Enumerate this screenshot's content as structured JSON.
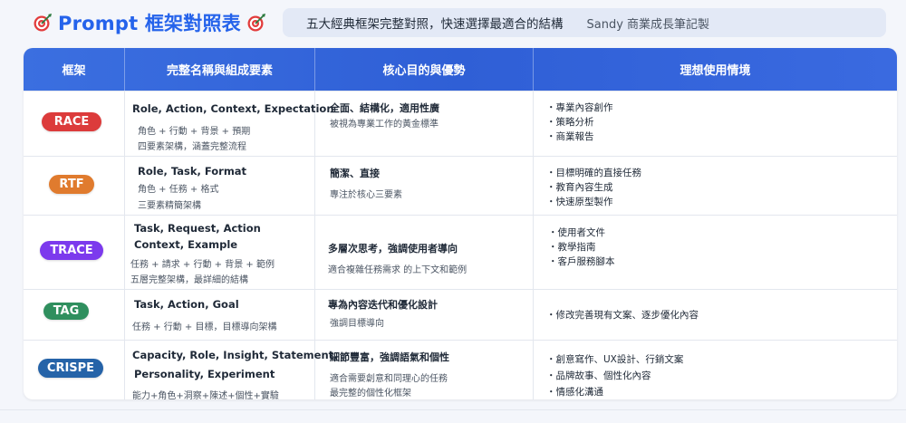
{
  "header": {
    "title": "Prompt 框架對照表",
    "subtitle": "五大經典框架完整對照，快速選擇最適合的結構",
    "author": "Sandy 商業成長筆記製"
  },
  "columns": [
    "框架",
    "完整名稱與組成要素",
    "核心目的與優勢",
    "理想使用情境"
  ],
  "colors": {
    "accent": "#2563eb",
    "race": "#dc3b3b",
    "rtf": "#e07b2e",
    "trace": "#7c3aed",
    "tag": "#2f8f5e",
    "crispe": "#2563a8"
  },
  "rows": [
    {
      "badge": "RACE",
      "name_lines": [
        "Role, Action, Context, Expectation"
      ],
      "zh_lines": [
        "角色 + 行動 + 背景 + 預期",
        "四要素架構，涵蓋完整流程"
      ],
      "purpose": "全面、結構化，適用性廣",
      "purpose_desc": [
        "被視為專業工作的黃金標準"
      ],
      "uses": [
        "・專業內容創作",
        "・策略分析",
        "・商業報告"
      ]
    },
    {
      "badge": "RTF",
      "name_lines": [
        "Role, Task, Format"
      ],
      "zh_lines": [
        "角色 + 任務 + 格式",
        "三要素精簡架構"
      ],
      "purpose": "簡潔、直接",
      "purpose_desc": [
        "專注於核心三要素"
      ],
      "uses": [
        "・目標明確的直接任務",
        "・教育內容生成",
        "・快速原型製作"
      ]
    },
    {
      "badge": "TRACE",
      "name_lines": [
        "Task, Request, Action",
        "Context, Example"
      ],
      "zh_lines": [
        "任務 + 請求 + 行動 + 背景 + 範例",
        "五層完整架構，最詳細的結構"
      ],
      "purpose": "多層次思考，強調使用者導向",
      "purpose_desc": [
        "適合複雜任務需求  的上下文和範例"
      ],
      "uses": [
        "・使用者文件",
        "・教學指南",
        "・客戶服務腳本"
      ]
    },
    {
      "badge": "TAG",
      "name_lines": [
        "Task, Action, Goal"
      ],
      "zh_lines": [
        "任務 + 行動 + 目標，目標導向架構"
      ],
      "purpose": "專為內容迭代和優化設計",
      "purpose_desc": [
        "強調目標導向"
      ],
      "uses": [
        "・修改完善現有文案、逐步優化內容"
      ]
    },
    {
      "badge": "CRISPE",
      "name_lines": [
        "Capacity, Role, Insight, Statement,",
        "Personality, Experiment"
      ],
      "zh_lines": [
        "能力+角色+洞察+陳述+個性+實驗"
      ],
      "purpose": "細節豐富，強調語氣和個性",
      "purpose_desc": [
        "適合需要創意和同理心的任務",
        "最完整的個性化框架"
      ],
      "uses": [
        "・創意寫作、UX設計、行銷文案",
        "・品牌故事、個性化內容",
        "・情感化溝通"
      ]
    }
  ]
}
